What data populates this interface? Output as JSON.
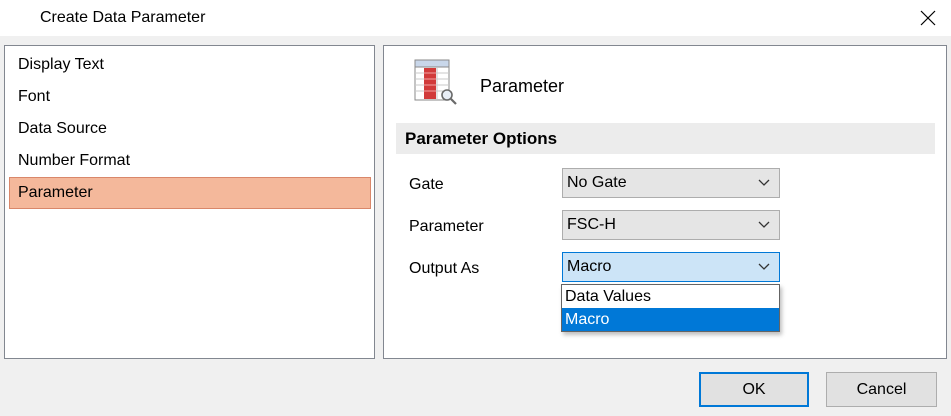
{
  "window": {
    "title": "Create Data Parameter",
    "close_icon": "close-icon"
  },
  "nav": {
    "items": [
      {
        "label": "Display Text"
      },
      {
        "label": "Font"
      },
      {
        "label": "Data Source"
      },
      {
        "label": "Number Format"
      },
      {
        "label": "Parameter"
      }
    ],
    "selected": "Parameter"
  },
  "panel": {
    "icon": "parameter-table-icon",
    "title": "Parameter",
    "section_title": "Parameter Options",
    "fields": [
      {
        "label": "Gate",
        "value": "No Gate"
      },
      {
        "label": "Parameter",
        "value": "FSC-H"
      },
      {
        "label": "Output As",
        "value": "Macro"
      }
    ],
    "dropdown": {
      "options": [
        "Data Values",
        "Macro"
      ],
      "highlighted": "Macro"
    }
  },
  "buttons": {
    "ok": "OK",
    "cancel": "Cancel"
  },
  "colors": {
    "selected_nav_bg": "#f4b89b",
    "selected_nav_border": "#d9876a",
    "accent": "#0078d7",
    "active_combo_bg": "#cce4f7"
  }
}
